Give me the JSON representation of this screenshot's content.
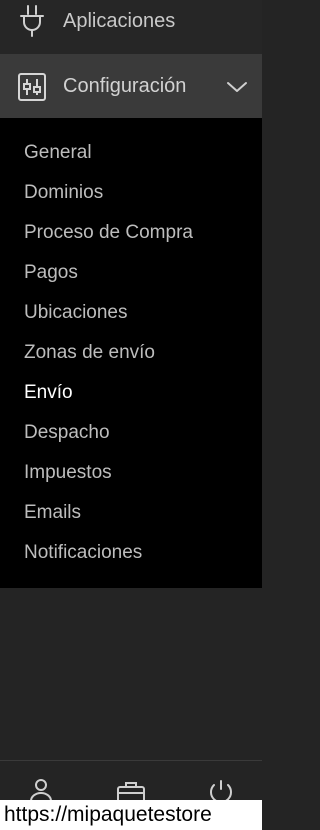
{
  "nav": {
    "apps_label": "Aplicaciones",
    "config_label": "Configuración",
    "config_expanded": true
  },
  "submenu": {
    "items": [
      {
        "label": "General",
        "active": false
      },
      {
        "label": "Dominios",
        "active": false
      },
      {
        "label": "Proceso de Compra",
        "active": false
      },
      {
        "label": "Pagos",
        "active": false
      },
      {
        "label": "Ubicaciones",
        "active": false
      },
      {
        "label": "Zonas de envío",
        "active": false
      },
      {
        "label": "Envío",
        "active": true
      },
      {
        "label": "Despacho",
        "active": false
      },
      {
        "label": "Impuestos",
        "active": false
      },
      {
        "label": "Emails",
        "active": false
      },
      {
        "label": "Notificaciones",
        "active": false
      }
    ]
  },
  "footer": {
    "icons": [
      "user-icon",
      "briefcase-icon",
      "power-icon"
    ]
  },
  "status": {
    "url": "https://mipaquetestore"
  },
  "colors": {
    "sidebar_bg": "#242424",
    "active_bg": "#3a3a3a",
    "submenu_bg": "#000000",
    "text": "#c9c9c9",
    "active_text": "#ffffff"
  }
}
